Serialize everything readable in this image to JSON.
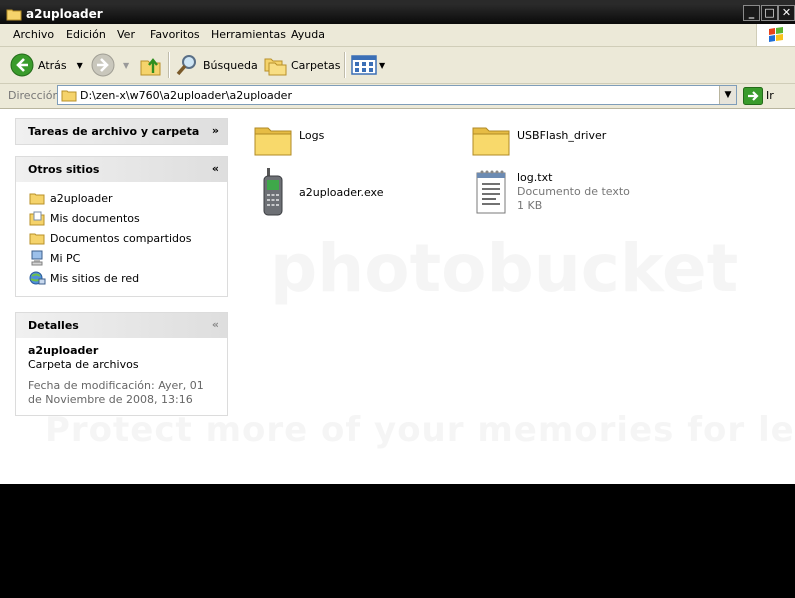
{
  "window": {
    "title": "a2uploader"
  },
  "menu": [
    "Archivo",
    "Edición",
    "Ver",
    "Favoritos",
    "Herramientas",
    "Ayuda"
  ],
  "toolbar": {
    "back": "Atrás",
    "search": "Búsqueda",
    "folders": "Carpetas"
  },
  "address": {
    "label": "Dirección",
    "path": "D:\\zen-x\\w760\\a2uploader\\a2uploader",
    "go": "Ir"
  },
  "panels": {
    "tasks": {
      "title": "Tareas de archivo y carpeta"
    },
    "other": {
      "title": "Otros sitios",
      "items": [
        {
          "label": "a2uploader",
          "icon": "folder-icon"
        },
        {
          "label": "Mis documentos",
          "icon": "my-documents-icon"
        },
        {
          "label": "Documentos compartidos",
          "icon": "folder-icon"
        },
        {
          "label": "Mi PC",
          "icon": "my-computer-icon"
        },
        {
          "label": "Mis sitios de red",
          "icon": "network-places-icon"
        }
      ]
    },
    "details": {
      "title": "Detalles",
      "name": "a2uploader",
      "type": "Carpeta de archivos",
      "modified": "Fecha de modificación: Ayer, 01 de Noviembre de 2008, 13:16"
    }
  },
  "files": [
    {
      "name": "Logs",
      "icon": "folder-icon"
    },
    {
      "name": "USBFlash_driver",
      "icon": "folder-icon"
    },
    {
      "name": "a2uploader.exe",
      "icon": "phone-app-icon"
    },
    {
      "name": "log.txt",
      "type": "Documento de texto",
      "size": "1 KB",
      "icon": "notepad-icon"
    }
  ],
  "watermark": {
    "brand": "photobucket",
    "tagline": "Protect more of your memories for less!"
  }
}
